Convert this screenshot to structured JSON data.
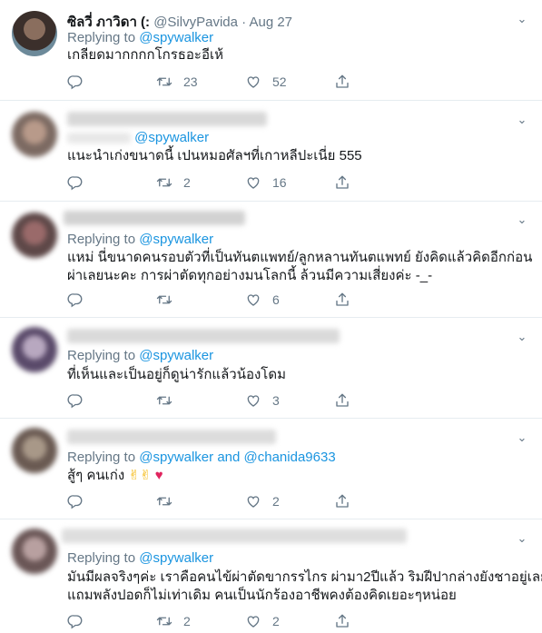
{
  "tweets": [
    {
      "name": "ซิลวี่ ภาวิดา (:",
      "handle": "@SilvyPavida",
      "dot": "·",
      "date": "Aug 27",
      "replying_label": "Replying to",
      "mention": "@spywalker",
      "text": "เกลียดมากกกกโกรธอะอีเห้",
      "replies": "",
      "retweets": "23",
      "likes": "52"
    },
    {
      "replying_label": "",
      "mention": "@spywalker",
      "text": "แนะนำเก่งขนาดนี้ เปนหมอศัลฯที่เกาหลีปะเนี่ย 555",
      "retweets": "2",
      "likes": "16"
    },
    {
      "replying_label": "Replying to",
      "mention": "@spywalker",
      "text_line1": "แหม่ นี่ขนาดคนรอบตัวที่เป็นทันตแพทย์/ลูกหลานทันตแพทย์ ยังคิดแล้วคิดอีกก่อน",
      "text_line2": "ผ่าเลยนะคะ  การผ่าตัดทุกอย่างมนโลกนี้ ล้วนมีความเสี่ยงค่ะ -_-",
      "retweets": "",
      "likes": "6"
    },
    {
      "replying_label": "Replying to",
      "mention": "@spywalker",
      "text": "ที่เห็นและเป็นอยู่ก็ดูน่ารักแล้วน้องโดม",
      "retweets": "",
      "likes": "3"
    },
    {
      "replying_label": "Replying to",
      "mention": "@spywalker",
      "and_label": "and",
      "mention2": "@chanida9633",
      "text": "สู้ๆ คนเก่ง",
      "emoji": "✌✌",
      "heart": "♥",
      "retweets": "",
      "likes": "2"
    },
    {
      "replying_label": "Replying to",
      "mention": "@spywalker",
      "text_line1": "มันมีผลจริงๆค่ะ เราคือคนไข้ผ่าตัดขากรรไกร ผ่ามา2ปีแล้ว ริมฝีปากล่างยังชาอยู่เลย",
      "text_line2": "แถมพลังปอดก็ไม่เท่าเดิม คนเป็นนักร้องอาชีพคงต้องคิดเยอะๆหน่อย",
      "retweets": "2",
      "likes": "2"
    }
  ],
  "colors": {
    "accent": "#1b95e0",
    "muted": "#657786",
    "text": "#14171a",
    "heart": "#e0245e"
  },
  "icons": [
    "reply-icon",
    "retweet-icon",
    "like-icon",
    "share-icon",
    "caret-down-icon"
  ]
}
